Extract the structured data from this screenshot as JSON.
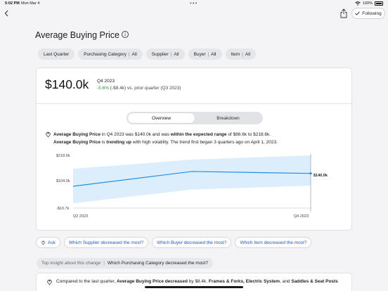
{
  "status_bar": {
    "time": "5:02 PM",
    "date": "Mon Mar 4",
    "dots": "•••",
    "battery": "100%"
  },
  "header": {
    "follow_label": "Following"
  },
  "title": "Average Buying Price",
  "filters": [
    {
      "label": "Last Quarter",
      "value": ""
    },
    {
      "label": "Purchasing Category",
      "value": "All"
    },
    {
      "label": "Supplier",
      "value": "All"
    },
    {
      "label": "Buyer",
      "value": "All"
    },
    {
      "label": "Item",
      "value": "All"
    }
  ],
  "kpi": {
    "value": "$140.0k",
    "period": "Q4 2023",
    "delta_pct": "-5.6%",
    "delta_rest": " (-$8.4k) vs. prior quarter (Q3 2023)"
  },
  "tabs": {
    "overview": "Overview",
    "breakdown": "Breakdown"
  },
  "summary": {
    "l1_a": "Average Buying Price",
    "l1_b": " in Q4 2023 was $140.0k and was ",
    "l1_c": "within the expected range",
    "l1_d": " of $86.6k to $218.6k.",
    "l2_a": "Average Buying Price",
    "l2_b": " is ",
    "l2_c": "trending up",
    "l2_d": " with high volatility. The trend first began 3 quarters ago on April 1, 2023."
  },
  "chart_data": {
    "type": "line",
    "x": [
      "Q2 2023",
      "Q3 2023",
      "Q4 2023"
    ],
    "series": [
      {
        "values": [
          84,
          148.4,
          140.0
        ]
      }
    ],
    "band_upper": [
      160,
      200,
      218.6
    ],
    "band_lower": [
      10,
      70,
      86.6
    ],
    "ylim": [
      -10.7,
      218.6
    ],
    "y_ticks": [
      "$218.6k",
      "$104.0k",
      "-$10.7k"
    ],
    "x_ticks": [
      "Q2 2023",
      "Q4 2023"
    ],
    "end_label": "$140.0k",
    "colors": {
      "line": "#1e8fe6",
      "band": "#dceefb"
    }
  },
  "actions": {
    "ask": "Ask",
    "q1": "Which Supplier decreased the most?",
    "q2": "Which Buyer decreased the most?",
    "q3": "Which Item decreased the most?"
  },
  "insight": {
    "label": "Top insight about this change",
    "question": "Which Purchasing Category decreased the most?",
    "t1": "Compared to the last quarter, ",
    "t2": "Average Buying Price decreased",
    "t3": " by $8.4k. ",
    "t4": "Frames & Forks, Electric System",
    "t5": ", and ",
    "t6": "Saddles & Seat Posts"
  }
}
